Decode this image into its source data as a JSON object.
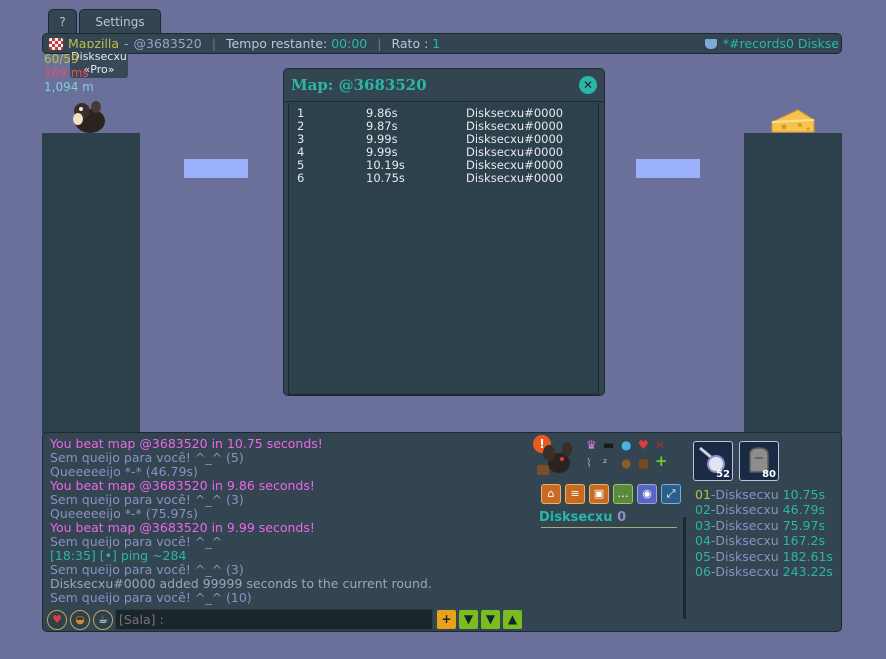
{
  "tabs": {
    "help": "?",
    "settings": "Settings"
  },
  "topbar": {
    "map_author": "Mapzilla",
    "map_separator": "-",
    "map_code": "@3683520",
    "time_label": "Tempo restante:",
    "time_value": "00:00",
    "rato_label": "Rato :",
    "rato_value": "1",
    "room": "*#records0 Diskse"
  },
  "player": {
    "name": "Disksecxu",
    "title": "«Pro»",
    "fps": "60/59",
    "ping": "169 ms",
    "distance": "1,094 m"
  },
  "map_popup": {
    "title": "Map: @3683520",
    "close": "✕",
    "records": [
      {
        "rank": "1",
        "time": "9.86s",
        "player": "Disksecxu#0000"
      },
      {
        "rank": "2",
        "time": "9.87s",
        "player": "Disksecxu#0000"
      },
      {
        "rank": "3",
        "time": "9.99s",
        "player": "Disksecxu#0000"
      },
      {
        "rank": "4",
        "time": "9.99s",
        "player": "Disksecxu#0000"
      },
      {
        "rank": "5",
        "time": "10.19s",
        "player": "Disksecxu#0000"
      },
      {
        "rank": "6",
        "time": "10.75s",
        "player": "Disksecxu#0000"
      }
    ]
  },
  "chat": {
    "lines": [
      "You beat map @3683520 in 10.75 seconds!",
      "Sem queijo para você! ^_^ (5)",
      "Queeeeeijo *-* (46.79s)",
      "You beat map @3683520 in 9.86 seconds!",
      "Sem queijo para você! ^_^ (3)",
      "Queeeeeijo *-* (75.97s)",
      "You beat map @3683520 in 9.99 seconds!",
      "Sem queijo para você! ^_^",
      "[18:35] [•] ping ~284",
      "Sem queijo para você! ^_^ (3)",
      "Disksecxu#0000 added 99999 seconds to the current round.",
      "Sem queijo para você! ^_^ (10)"
    ],
    "input_placeholder": "[Sala] :"
  },
  "room_panel": {
    "player_name": "Disksecxu",
    "score": "0"
  },
  "inventory": [
    {
      "icon": "magnifier-icon",
      "count": "52"
    },
    {
      "icon": "tombstone-icon",
      "count": "80"
    }
  ],
  "ranking": [
    {
      "pos": "01",
      "name": "-Disksecxu",
      "time": "10.75s"
    },
    {
      "pos": "02",
      "name": "-Disksecxu",
      "time": "46.79s"
    },
    {
      "pos": "03",
      "name": "-Disksecxu",
      "time": "75.97s"
    },
    {
      "pos": "04",
      "name": "-Disksecxu",
      "time": "167.2s"
    },
    {
      "pos": "05",
      "name": "-Disksecxu",
      "time": "182.61s"
    },
    {
      "pos": "06",
      "name": "-Disksecxu",
      "time": "243.22s"
    }
  ],
  "colors": {
    "background": "#6a7099",
    "panel": "#324550",
    "accent_teal": "#2ab7a7",
    "accent_yellow": "#bebf4b",
    "chat_pink": "#ed67ea",
    "chat_lavender": "#8a91c5"
  }
}
